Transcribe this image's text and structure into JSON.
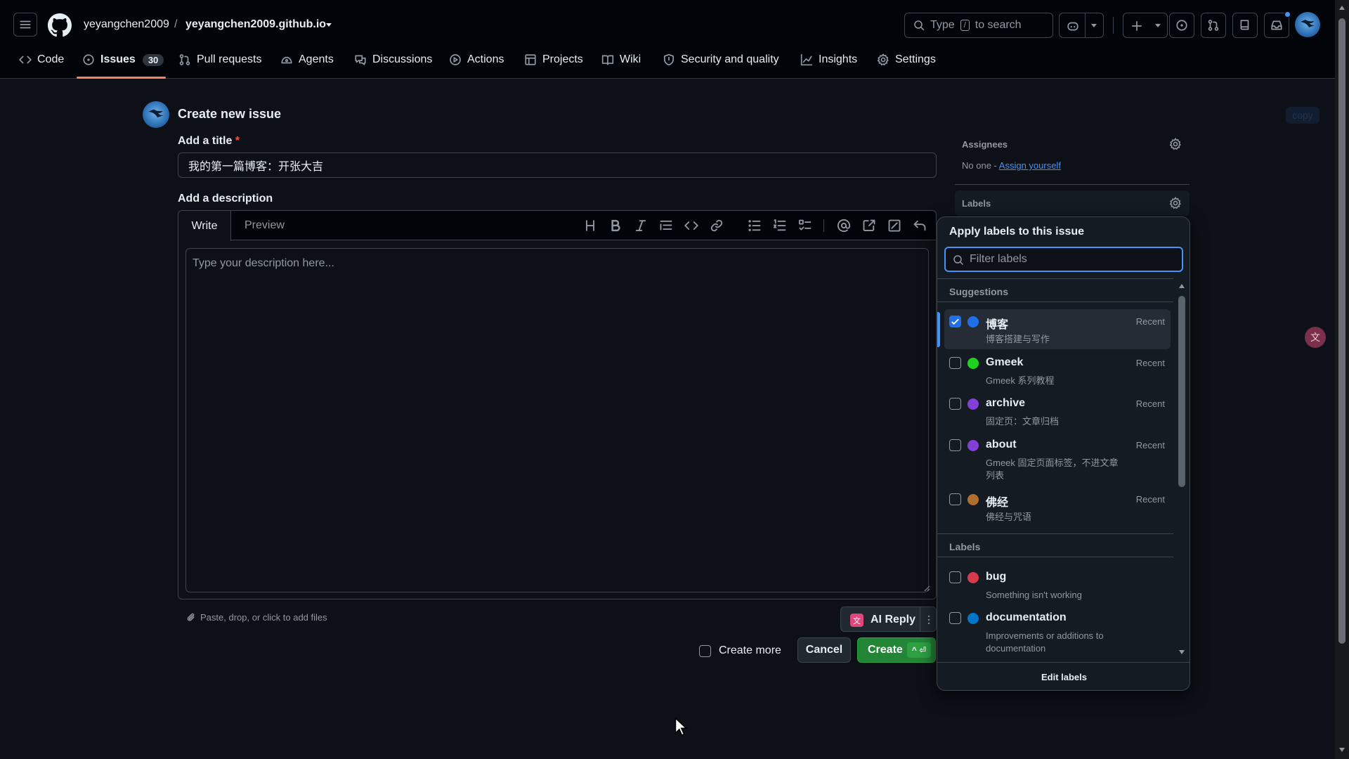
{
  "header": {
    "owner": "yeyangchen2009",
    "separator": "/",
    "repo": "yeyangchen2009.github.io",
    "search_text_before": "Type",
    "search_key": "/",
    "search_text_after": "to search"
  },
  "nav": {
    "tabs": [
      {
        "label": "Code",
        "icon": "code-icon"
      },
      {
        "label": "Issues",
        "icon": "issue-icon",
        "count": "30",
        "active": true
      },
      {
        "label": "Pull requests",
        "icon": "pull-request-icon"
      },
      {
        "label": "Agents",
        "icon": "agent-icon"
      },
      {
        "label": "Discussions",
        "icon": "discussion-icon"
      },
      {
        "label": "Actions",
        "icon": "play-icon"
      },
      {
        "label": "Projects",
        "icon": "table-icon"
      },
      {
        "label": "Wiki",
        "icon": "book-icon"
      },
      {
        "label": "Security and quality",
        "icon": "shield-icon"
      },
      {
        "label": "Insights",
        "icon": "graph-icon"
      },
      {
        "label": "Settings",
        "icon": "gear-icon"
      }
    ]
  },
  "form": {
    "heading": "Create new issue",
    "copy_label": "copy",
    "title_label": "Add a title",
    "required_mark": "*",
    "title_value": "我的第一篇博客：开张大吉",
    "description_label": "Add a description",
    "write_tab": "Write",
    "preview_tab": "Preview",
    "description_placeholder": "Type your description here...",
    "attach_hint": "Paste, drop, or click to add files",
    "ai_reply": "AI Reply",
    "create_more": "Create more",
    "cancel": "Cancel",
    "create": "Create",
    "create_shortcut": "^ ⏎"
  },
  "sidebar": {
    "assignees_title": "Assignees",
    "assignees_none": "No one -",
    "assign_yourself": "Assign yourself",
    "labels_title": "Labels"
  },
  "labels_panel": {
    "title": "Apply labels to this issue",
    "filter_placeholder": "Filter labels",
    "suggestions_heading": "Suggestions",
    "labels_heading": "Labels",
    "edit_labels": "Edit labels",
    "suggestions": [
      {
        "name": "博客",
        "description": "博客搭建与写作",
        "tag": "Recent",
        "color": "#1f6feb",
        "checked": true
      },
      {
        "name": "Gmeek",
        "description": "Gmeek 系列教程",
        "tag": "Recent",
        "color": "#1fd21f",
        "checked": false
      },
      {
        "name": "archive",
        "description": "固定页：文章归档",
        "tag": "Recent",
        "color": "#8240d8",
        "checked": false
      },
      {
        "name": "about",
        "description": "Gmeek 固定页面标签，不进文章列表",
        "tag": "Recent",
        "color": "#8240d8",
        "checked": false
      },
      {
        "name": "佛经",
        "description": "佛经与咒语",
        "tag": "Recent",
        "color": "#b06f2d",
        "checked": false
      }
    ],
    "labels": [
      {
        "name": "bug",
        "description": "Something isn't working",
        "color": "#d73a4a",
        "checked": false
      },
      {
        "name": "documentation",
        "description": "Improvements or additions to documentation",
        "color": "#0075ca",
        "checked": false
      }
    ]
  }
}
